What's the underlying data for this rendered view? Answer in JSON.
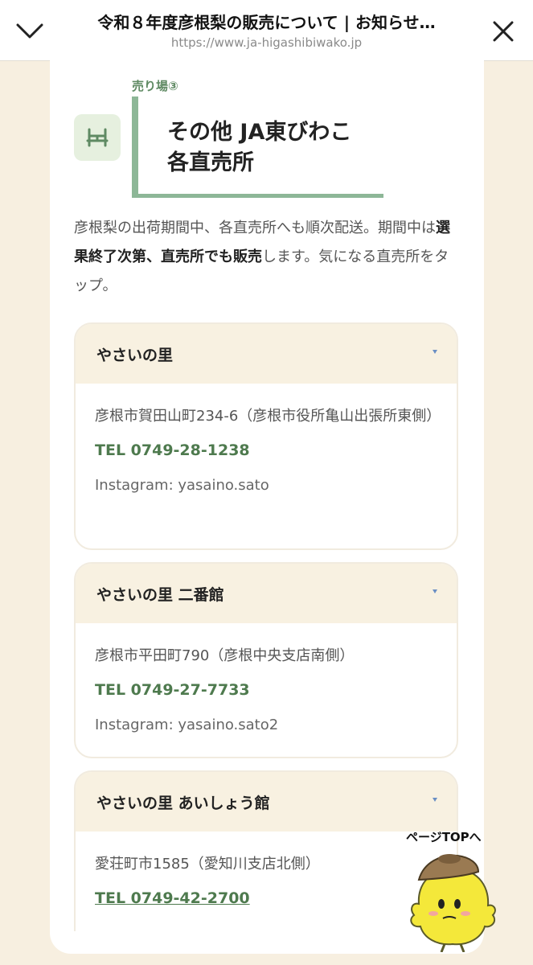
{
  "browser": {
    "title": "令和８年度彦根梨の販売について | お知らせ…",
    "url": "https://www.ja-higashibiwako.jp"
  },
  "section": {
    "tag": "売り場③",
    "heading_line1": "その他 JA東びわこ",
    "heading_line2": "各直売所",
    "icon": "shop-stall-icon"
  },
  "intro": {
    "part1": "彦根梨の出荷期間中、各直売所へも順次配送。期間中は",
    "bold": "選果終了次第、直売所でも販売",
    "part2": "します。気になる直売所をタップ。"
  },
  "shops": [
    {
      "name": "やさいの里",
      "address": "彦根市賀田山町234-6（彦根市役所亀山出張所東側）",
      "tel": "TEL 0749-28-1238",
      "instagram": "Instagram: yasaino.sato"
    },
    {
      "name": "やさいの里 二番館",
      "address": "彦根市平田町790（彦根中央支店南側）",
      "tel": "TEL 0749-27-7733",
      "instagram": "Instagram: yasaino.sato2"
    },
    {
      "name": "やさいの里 あいしょう館",
      "address": "愛荘町市1585（愛知川支店北側）",
      "tel": "TEL 0749-42-2700"
    }
  ],
  "page_top": {
    "label": "ページTOPへ"
  },
  "colors": {
    "accent_green": "#8db797",
    "tel_green": "#4e7a4e",
    "header_beige": "#f8f1e1",
    "background": "#f7efe0"
  }
}
